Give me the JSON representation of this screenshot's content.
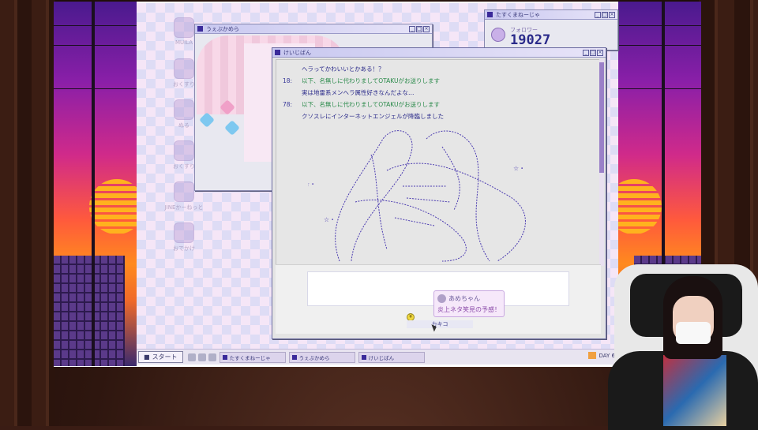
{
  "desktop": {
    "icons": [
      {
        "label": "MUILA",
        "icon": "mail-icon"
      },
      {
        "label": "おくすり",
        "icon": "pill-icon"
      },
      {
        "label": "ぬる",
        "icon": "palette-icon"
      },
      {
        "label": "おくすり",
        "icon": "drug-icon"
      },
      {
        "label": "JINEかーねっと",
        "icon": "network-icon"
      },
      {
        "label": "おでかけ",
        "icon": "outing-icon"
      }
    ]
  },
  "web_window": {
    "title": "うぇぶかめら"
  },
  "follower_window": {
    "title": "たすくまねーじゃ",
    "label": "フォロワー",
    "count": "19027"
  },
  "bbs_window": {
    "title": "けいじばん",
    "posts": [
      {
        "num": "",
        "text": "ヘラってかわいいとかある！？",
        "kind": "normal"
      },
      {
        "num": "18:",
        "text": "以下、名無しに代わりましてOTAKUがお送りします",
        "kind": "green"
      },
      {
        "num": "",
        "text": "実は地雷系メンヘラ属性好きなんだよな…",
        "kind": "normal"
      },
      {
        "num": "78:",
        "text": "以下、名無しに代わりましてOTAKUがお送りします",
        "kind": "green"
      },
      {
        "num": "",
        "text": "クソスレにインターネットエンジェルが降臨しました",
        "kind": "normal"
      }
    ],
    "post_button": "カキコ"
  },
  "tooltip": {
    "user": "あめちゃん",
    "message": "炎上ネタ笑見の予感！"
  },
  "taskbar": {
    "start_label": "スタート",
    "tasks": [
      "たすくまねーじゃ",
      "うぇぶかめら",
      "けいじばん"
    ],
    "day": "DAY 6"
  },
  "colors": {
    "accent": "#3a2a9a",
    "green_text": "#2a8a4a",
    "text_blue": "#2a2a8a"
  }
}
